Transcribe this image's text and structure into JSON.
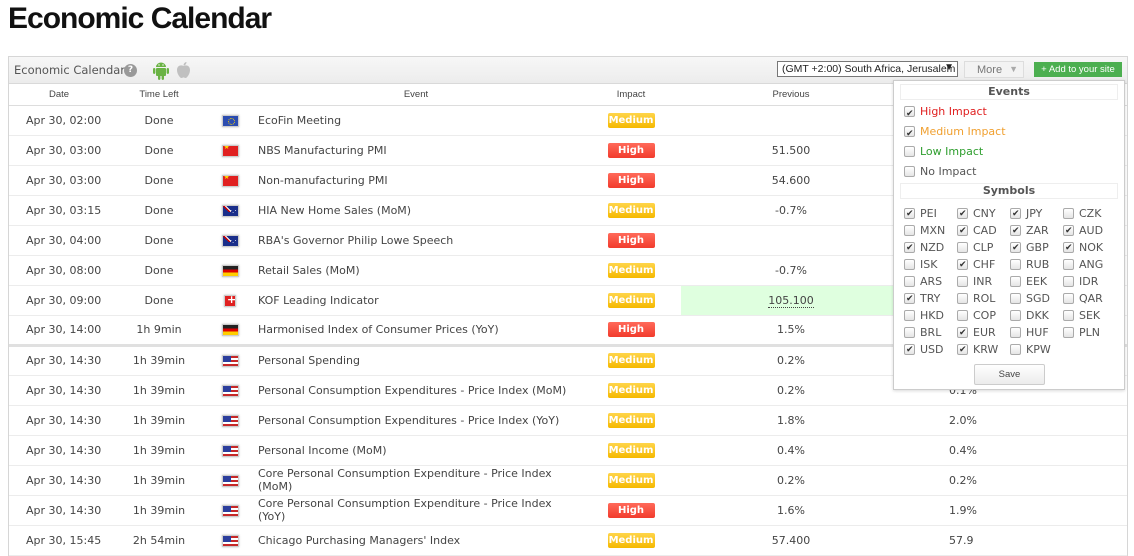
{
  "page_title": "Economic Calendar",
  "toolbar": {
    "title": "Economic Calendar",
    "help_icon": "?",
    "timezone": "(GMT +2:00) South Africa, Jerusalem",
    "timezone_arrow": "▼",
    "more_label": "More",
    "more_caret": "▼",
    "add_site_label": "+ Add to your site"
  },
  "columns": [
    "Date",
    "Time Left",
    "",
    "Event",
    "Impact",
    "Previous",
    ""
  ],
  "rows": [
    {
      "date": "Apr 30, 02:00",
      "left": "Done",
      "flag": "eu",
      "event": "EcoFin Meeting",
      "impact": "Medium",
      "impact_level": "medium",
      "previous": "",
      "forecast": ""
    },
    {
      "date": "Apr 30, 03:00",
      "left": "Done",
      "flag": "cn",
      "event": "NBS Manufacturing PMI",
      "impact": "High",
      "impact_level": "high",
      "previous": "51.500",
      "forecast": ""
    },
    {
      "date": "Apr 30, 03:00",
      "left": "Done",
      "flag": "cn",
      "event": "Non-manufacturing PMI",
      "impact": "High",
      "impact_level": "high",
      "previous": "54.600",
      "forecast": ""
    },
    {
      "date": "Apr 30, 03:15",
      "left": "Done",
      "flag": "au",
      "event": "HIA New Home Sales (MoM)",
      "impact": "Medium",
      "impact_level": "medium",
      "previous": "-0.7%",
      "forecast": ""
    },
    {
      "date": "Apr 30, 04:00",
      "left": "Done",
      "flag": "au",
      "event": "RBA's Governor Philip Lowe Speech",
      "impact": "High",
      "impact_level": "high",
      "previous": "",
      "forecast": ""
    },
    {
      "date": "Apr 30, 08:00",
      "left": "Done",
      "flag": "de",
      "event": "Retail Sales (MoM)",
      "impact": "Medium",
      "impact_level": "medium",
      "previous": "-0.7%",
      "forecast": ""
    },
    {
      "date": "Apr 30, 09:00",
      "left": "Done",
      "flag": "ch",
      "event": "KOF Leading Indicator",
      "impact": "Medium",
      "impact_level": "medium",
      "previous": "105.100",
      "forecast": "",
      "highlight": true
    },
    {
      "date": "Apr 30, 14:00",
      "left": "1h 9min",
      "flag": "de",
      "event": "Harmonised Index of Consumer Prices (YoY)",
      "impact": "High",
      "impact_level": "high",
      "previous": "1.5%",
      "forecast": "",
      "separator": true
    },
    {
      "date": "Apr 30, 14:30",
      "left": "1h 39min",
      "flag": "us",
      "event": "Personal Spending",
      "impact": "Medium",
      "impact_level": "medium",
      "previous": "0.2%",
      "forecast": ""
    },
    {
      "date": "Apr 30, 14:30",
      "left": "1h 39min",
      "flag": "us",
      "event": "Personal Consumption Expenditures - Price Index (MoM)",
      "impact": "Medium",
      "impact_level": "medium",
      "previous": "0.2%",
      "forecast": "0.1%"
    },
    {
      "date": "Apr 30, 14:30",
      "left": "1h 39min",
      "flag": "us",
      "event": "Personal Consumption Expenditures - Price Index (YoY)",
      "impact": "Medium",
      "impact_level": "medium",
      "previous": "1.8%",
      "forecast": "2.0%"
    },
    {
      "date": "Apr 30, 14:30",
      "left": "1h 39min",
      "flag": "us",
      "event": "Personal Income (MoM)",
      "impact": "Medium",
      "impact_level": "medium",
      "previous": "0.4%",
      "forecast": "0.4%"
    },
    {
      "date": "Apr 30, 14:30",
      "left": "1h 39min",
      "flag": "us",
      "event": "Core Personal Consumption Expenditure - Price Index (MoM)",
      "impact": "Medium",
      "impact_level": "medium",
      "previous": "0.2%",
      "forecast": "0.2%"
    },
    {
      "date": "Apr 30, 14:30",
      "left": "1h 39min",
      "flag": "us",
      "event": "Core Personal Consumption Expenditure - Price Index (YoY)",
      "impact": "High",
      "impact_level": "high",
      "previous": "1.6%",
      "forecast": "1.9%"
    },
    {
      "date": "Apr 30, 15:45",
      "left": "2h 54min",
      "flag": "us",
      "event": "Chicago Purchasing Managers' Index",
      "impact": "Medium",
      "impact_level": "medium",
      "previous": "57.400",
      "forecast": "57.9"
    }
  ],
  "filter": {
    "events_title": "Events",
    "events": [
      {
        "label": "High Impact",
        "checked": true,
        "color": "#e02020"
      },
      {
        "label": "Medium Impact",
        "checked": true,
        "color": "#f0a030"
      },
      {
        "label": "Low Impact",
        "checked": false,
        "color": "#2e9e2e"
      },
      {
        "label": "No Impact",
        "checked": false,
        "color": "#555555"
      }
    ],
    "symbols_title": "Symbols",
    "symbols": [
      {
        "label": "PEI",
        "checked": true
      },
      {
        "label": "CNY",
        "checked": true
      },
      {
        "label": "JPY",
        "checked": true
      },
      {
        "label": "CZK",
        "checked": false
      },
      {
        "label": "MXN",
        "checked": false
      },
      {
        "label": "CAD",
        "checked": true
      },
      {
        "label": "ZAR",
        "checked": true
      },
      {
        "label": "AUD",
        "checked": true
      },
      {
        "label": "NZD",
        "checked": true
      },
      {
        "label": "CLP",
        "checked": false
      },
      {
        "label": "GBP",
        "checked": true
      },
      {
        "label": "NOK",
        "checked": true
      },
      {
        "label": "ISK",
        "checked": false
      },
      {
        "label": "CHF",
        "checked": true
      },
      {
        "label": "RUB",
        "checked": false
      },
      {
        "label": "ANG",
        "checked": false
      },
      {
        "label": "ARS",
        "checked": false
      },
      {
        "label": "INR",
        "checked": false
      },
      {
        "label": "EEK",
        "checked": false
      },
      {
        "label": "IDR",
        "checked": false
      },
      {
        "label": "TRY",
        "checked": true
      },
      {
        "label": "ROL",
        "checked": false
      },
      {
        "label": "SGD",
        "checked": false
      },
      {
        "label": "QAR",
        "checked": false
      },
      {
        "label": "HKD",
        "checked": false
      },
      {
        "label": "COP",
        "checked": false
      },
      {
        "label": "DKK",
        "checked": false
      },
      {
        "label": "SEK",
        "checked": false
      },
      {
        "label": "BRL",
        "checked": false
      },
      {
        "label": "EUR",
        "checked": true
      },
      {
        "label": "HUF",
        "checked": false
      },
      {
        "label": "PLN",
        "checked": false
      },
      {
        "label": "USD",
        "checked": true
      },
      {
        "label": "KRW",
        "checked": true
      },
      {
        "label": "KPW",
        "checked": false
      }
    ],
    "save_label": "Save"
  },
  "colors": {
    "high": "#f23b2c",
    "medium": "#f5b800",
    "add_button": "#4caf50",
    "highlight_bg": "#dfffdf"
  }
}
